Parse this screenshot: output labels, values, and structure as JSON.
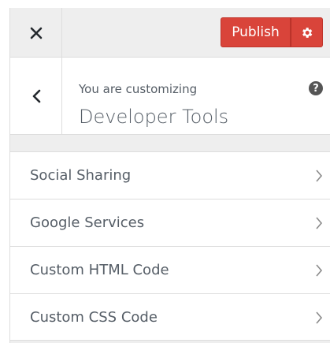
{
  "header": {
    "publish_label": "Publish"
  },
  "info": {
    "subtitle": "You are customizing",
    "title": "Developer Tools",
    "help_symbol": "?"
  },
  "menu": {
    "items": [
      {
        "label": "Social Sharing"
      },
      {
        "label": "Google Services"
      },
      {
        "label": "Custom HTML Code"
      },
      {
        "label": "Custom CSS Code"
      }
    ]
  },
  "colors": {
    "publish_bg": "#d9443a",
    "panel_bg": "#eeeeee",
    "text": "#555d66"
  },
  "icons": {
    "close": "close-icon",
    "settings": "gear-icon",
    "back": "chevron-left-icon",
    "help": "help-icon",
    "item_arrow": "chevron-right-icon"
  }
}
